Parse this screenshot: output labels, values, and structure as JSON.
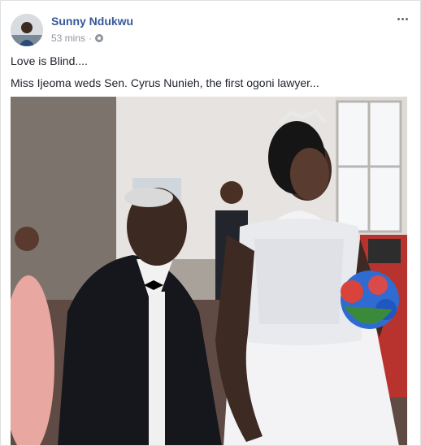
{
  "post": {
    "author": "Sunny Ndukwu",
    "time": "53 mins",
    "separator": "·",
    "privacy_icon": "globe-icon",
    "more_icon": "ellipsis-icon",
    "lines": [
      "Love is Blind....",
      "Miss Ijeoma weds Sen. Cyrus Nunieh, the first ogoni lawyer..."
    ]
  },
  "colors": {
    "author_link": "#365899",
    "meta_gray": "#90949c",
    "body_text": "#1d2129"
  }
}
